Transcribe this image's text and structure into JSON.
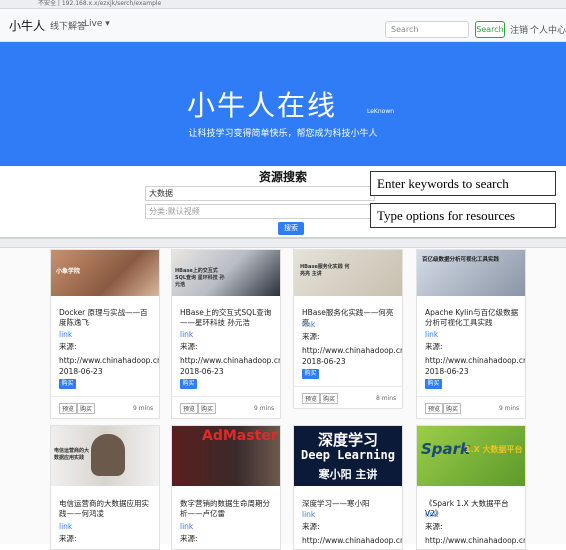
{
  "browser": {
    "url": "不安全 | 192.168.x.x/ezxjk/serch/example"
  },
  "navbar": {
    "brand": "小牛人",
    "links": [
      "线下解答",
      "Live ▾"
    ],
    "search_placeholder": "Search",
    "search_button": "Search",
    "logout": "注销",
    "profile": "个人中心"
  },
  "hero": {
    "title": "小牛人在线",
    "title_suffix": "LeKnown",
    "tagline": "让科技学习变得简单快乐，帮您成为科技小牛人",
    "background": "#2f7cf6"
  },
  "search": {
    "heading": "资源搜索",
    "keyword_value": "大数据",
    "category_placeholder": "分类:默认视频",
    "submit": "搜索"
  },
  "annotations": [
    "Enter keywords to search",
    "Type options for resources"
  ],
  "cards": [
    {
      "thumb_text": "小象学院",
      "title": "Docker 原理与实战——百度陈逸飞",
      "link": "link",
      "source_label": "来源:",
      "url": "http://www.chinahadoop.cn/",
      "date": "2018-06-23",
      "buy": "购买",
      "actions": [
        "预览",
        "购买"
      ],
      "duration": "9 mins"
    },
    {
      "thumb_text": "HBase上的交互式SQL查询 星环科技 孙元浩",
      "title": "HBase上的交互式SQL查询——星环科技 孙元浩",
      "link": "link",
      "source_label": "来源:",
      "url": "",
      "date": "",
      "buy": "购买",
      "actions": [
        "预览",
        "购买"
      ],
      "duration": "9 mins"
    },
    {
      "thumb_text": "HBase服务化实践 何亮亮 主讲",
      "title": "HBase服务化实践——何亮亮",
      "link": "link",
      "source_label": "来源:",
      "url": "http://www.chinahadoop.cn/",
      "date": "2018-06-23",
      "buy": "购买",
      "actions": [
        "预览",
        "购买"
      ],
      "duration": "8 mins"
    },
    {
      "thumb_text": "百亿级数据分析可视化工具实践",
      "title": "Apache Kylin与百亿级数据分析可视化工具实践",
      "link": "link",
      "source_label": "来源:",
      "url": "http://www.chinahadoop.cn/",
      "date": "2018-06-23",
      "buy": "购买",
      "actions": [
        "预览",
        "购买"
      ],
      "duration": "9 mins"
    },
    {
      "thumb_text": "电信运营商的大数据应用实践",
      "title": "电信运营商的大数据应用实践——何鸿凌",
      "link": "link",
      "source_label": "来源:",
      "url": "",
      "date": "",
      "buy": "",
      "actions": [],
      "duration": ""
    },
    {
      "thumb_text": "AdMaster",
      "title": "数字营销的数据生命周期分析——卢亿雷",
      "link": "link",
      "source_label": "来源:",
      "url": "",
      "date": "",
      "buy": "",
      "actions": [],
      "duration": ""
    },
    {
      "thumb_text": "深度学习",
      "thumb_text2": "Deep Learning",
      "thumb_text3": "寒小阳 主讲",
      "title": "深度学习——寒小阳",
      "link": "link",
      "source_label": "来源:",
      "url": "http://www.chinahadoop.cn/",
      "date": "",
      "buy": "",
      "actions": [],
      "duration": ""
    },
    {
      "thumb_text": "Spark",
      "thumb_text2": "1.X 大数据平台",
      "title": "《Spark 1.X 大数据平台V2》",
      "link": "link",
      "source_label": "来源:",
      "url": "http://www.chinahadoop.cn/",
      "date": "",
      "buy": "",
      "actions": [],
      "duration": ""
    }
  ]
}
